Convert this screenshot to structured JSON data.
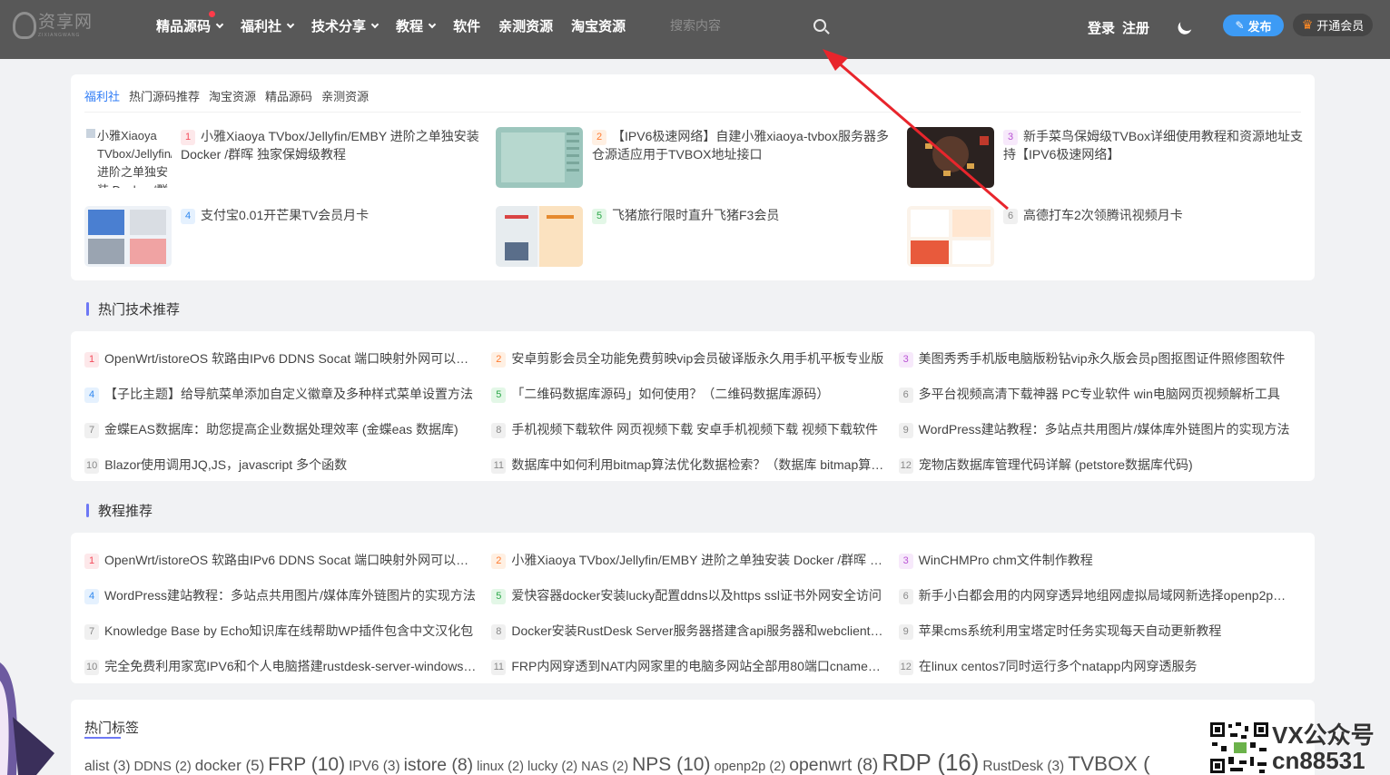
{
  "header": {
    "logo_name": "资享网",
    "logo_sub": "ZIXIANGWANG",
    "nav": [
      {
        "label": "精品源码",
        "dropdown": true,
        "dot": true
      },
      {
        "label": "福利社",
        "dropdown": true,
        "dot": false
      },
      {
        "label": "技术分享",
        "dropdown": true,
        "dot": false
      },
      {
        "label": "教程",
        "dropdown": true,
        "dot": false
      },
      {
        "label": "软件",
        "dropdown": false,
        "dot": false
      },
      {
        "label": "亲测资源",
        "dropdown": false,
        "dot": false
      },
      {
        "label": "淘宝资源",
        "dropdown": false,
        "dot": false
      }
    ],
    "search_placeholder": "搜索内容",
    "login": "登录",
    "register": "注册",
    "publish": "发布",
    "vip": "开通会员"
  },
  "featured": {
    "tabs": [
      "福利社",
      "热门源码推荐",
      "淘宝资源",
      "精品源码",
      "亲测资源"
    ],
    "active_tab": 0,
    "items": [
      {
        "num": "1",
        "title": "小雅Xiaoya TVbox/Jellyfin/EMBY 进阶之单独安装 Docker /群晖 独家保姆级教程",
        "alt": "小雅Xiaoya TVbox/Jellyfin/EMBY 进阶之单独安装 Docker /群晖"
      },
      {
        "num": "2",
        "title": "【IPV6极速网络】自建小雅xiaoya-tvbox服务器多仓源适应用于TVBOX地址接口"
      },
      {
        "num": "3",
        "title": "新手菜鸟保姆级TVBox详细使用教程和资源地址支持【IPV6极速网络】"
      },
      {
        "num": "4",
        "title": "支付宝0.01开芒果TV会员月卡"
      },
      {
        "num": "5",
        "title": "飞猪旅行限时直升飞猪F3会员"
      },
      {
        "num": "6",
        "title": "高德打车2次领腾讯视频月卡"
      }
    ]
  },
  "hot_tech": {
    "title": "热门技术推荐",
    "items": [
      {
        "num": "1",
        "title": "OpenWrt/istoreOS 软路由IPv6 DDNS Socat 端口映射外网可以访问"
      },
      {
        "num": "2",
        "title": "安卓剪影会员全功能免费剪映vip会员破译版永久用手机平板专业版"
      },
      {
        "num": "3",
        "title": "美图秀秀手机版电脑版粉钻vip永久版会员p图抠图证件照修图软件"
      },
      {
        "num": "4",
        "title": "【子比主题】给导航菜单添加自定义徽章及多种样式菜单设置方法"
      },
      {
        "num": "5",
        "title": "「二维码数据库源码」如何使用？（二维码数据库源码）"
      },
      {
        "num": "6",
        "title": "多平台视频高清下载神器 PC专业软件 win电脑网页视频解析工具"
      },
      {
        "num": "7",
        "title": "金蝶EAS数据库：助您提高企业数据处理效率 (金蝶eas 数据库)"
      },
      {
        "num": "8",
        "title": "手机视频下载软件 网页视频下载 安卓手机视频下载 视频下载软件"
      },
      {
        "num": "9",
        "title": "WordPress建站教程：多站点共用图片/媒体库外链图片的实现方法"
      },
      {
        "num": "10",
        "title": "Blazor使用调用JQ,JS，javascript 多个函数"
      },
      {
        "num": "11",
        "title": "数据库中如何利用bitmap算法优化数据检索？（数据库 bitmap算法）"
      },
      {
        "num": "12",
        "title": "宠物店数据库管理代码详解 (petstore数据库代码)"
      }
    ]
  },
  "tutorials": {
    "title": "教程推荐",
    "items": [
      {
        "num": "1",
        "title": "OpenWrt/istoreOS 软路由IPv6 DDNS Socat 端口映射外网可以访问"
      },
      {
        "num": "2",
        "title": "小雅Xiaoya TVbox/Jellyfin/EMBY 进阶之单独安装 Docker /群晖 独家保姆级教程"
      },
      {
        "num": "3",
        "title": "WinCHMPro chm文件制作教程"
      },
      {
        "num": "4",
        "title": "WordPress建站教程：多站点共用图片/媒体库外链图片的实现方法"
      },
      {
        "num": "5",
        "title": "爱快容器docker安装lucky配置ddns以及https ssl证书外网安全访问"
      },
      {
        "num": "6",
        "title": "新手小白都会用的内网穿透异地组网虚拟局域网新选择openp2p教程"
      },
      {
        "num": "7",
        "title": "Knowledge Base by Echo知识库在线帮助WP插件包含中文汉化包"
      },
      {
        "num": "8",
        "title": "Docker安装RustDesk Server服务器搭建含api服务器和webclient客户端"
      },
      {
        "num": "9",
        "title": "苹果cms系统利用宝塔定时任务实现每天自动更新教程"
      },
      {
        "num": "10",
        "title": "完全免费利用家宽IPV6和个人电脑搭建rustdesk-server-windows服务器"
      },
      {
        "num": "11",
        "title": "FRP内网穿透到NAT内网家里的电脑多网站全部用80端口cname解析"
      },
      {
        "num": "12",
        "title": "在linux centos7同时运行多个natapp内网穿透服务"
      }
    ]
  },
  "hot_tags": {
    "title": "热门标签",
    "tags": [
      {
        "name": "alist",
        "count": "(3)",
        "size": 3
      },
      {
        "name": "DDNS",
        "count": "(2)",
        "size": 2
      },
      {
        "name": "docker",
        "count": "(5)",
        "size": 5
      },
      {
        "name": "FRP",
        "count": "(10)",
        "size": 10
      },
      {
        "name": "IPV6",
        "count": "(3)",
        "size": 3
      },
      {
        "name": "istore",
        "count": "(8)",
        "size": 8
      },
      {
        "name": "linux",
        "count": "(2)",
        "size": 2
      },
      {
        "name": "lucky",
        "count": "(2)",
        "size": 2
      },
      {
        "name": "NAS",
        "count": "(2)",
        "size": 2
      },
      {
        "name": "NPS",
        "count": "(10)",
        "size": 10
      },
      {
        "name": "openp2p",
        "count": "(2)",
        "size": 2
      },
      {
        "name": "openwrt",
        "count": "(8)",
        "size": 8
      },
      {
        "name": "RDP",
        "count": "(16)",
        "size": 16
      },
      {
        "name": "RustDesk",
        "count": "(3)",
        "size": 3
      },
      {
        "name": "TVBOX",
        "count": "(",
        "size": 12
      }
    ]
  },
  "watermark": {
    "wechat": "VX公众号",
    "id": "cn88531"
  },
  "colors": {
    "header_bg": "#585858",
    "accent": "#2f7cf6",
    "section_bar": "#6d78f5",
    "publish_bg": "#3d9bf5",
    "arrow": "#e8252c"
  }
}
